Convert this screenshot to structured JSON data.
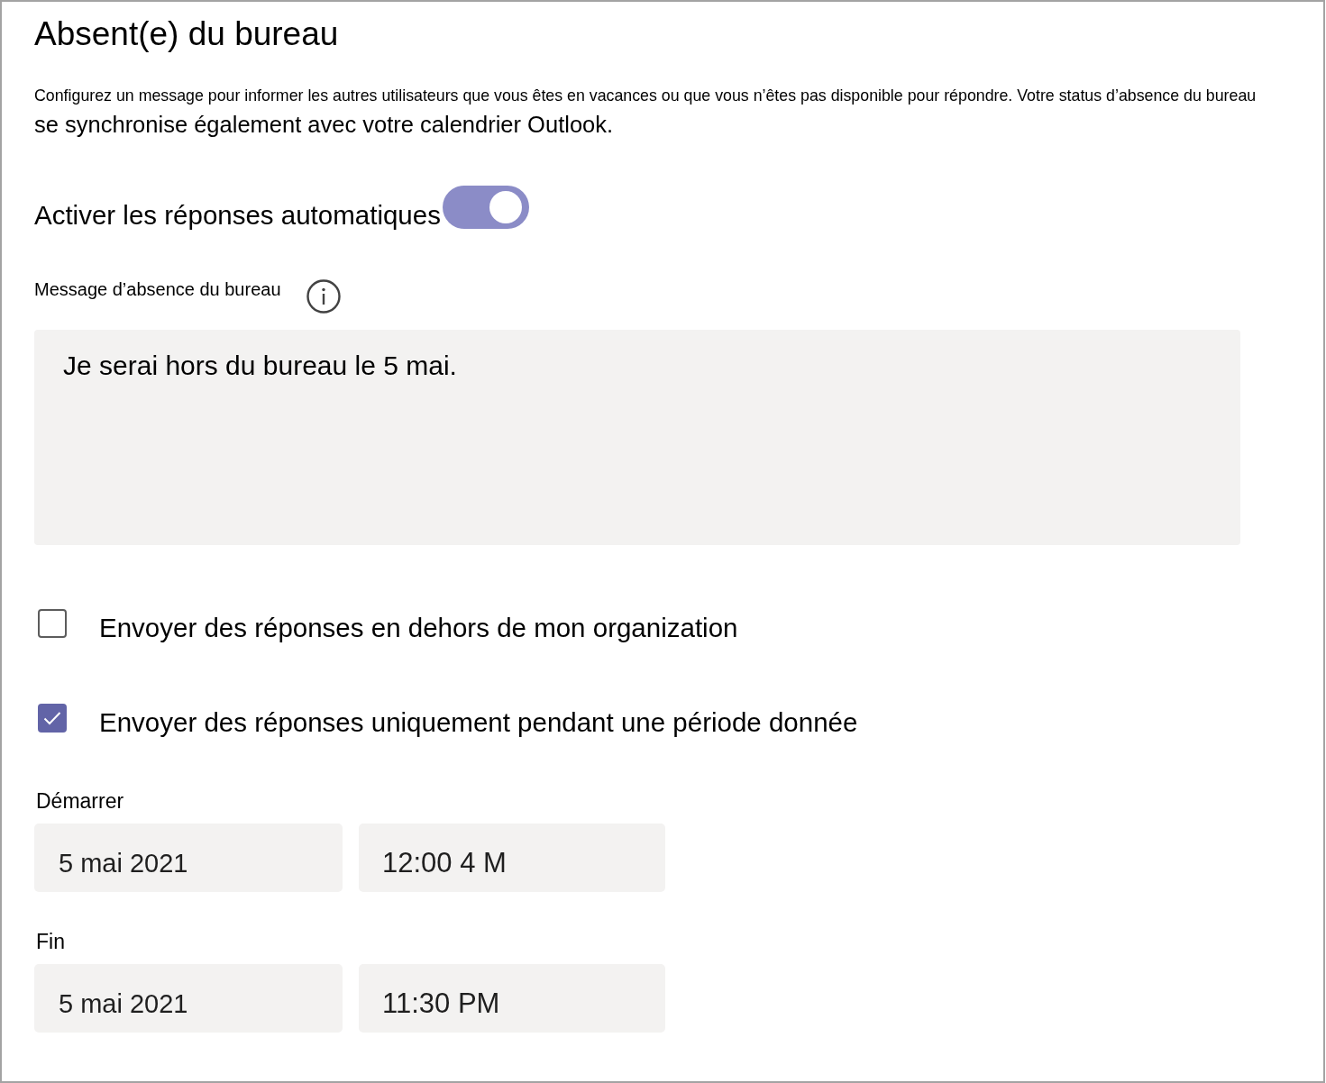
{
  "title": "Absent(e) du bureau",
  "description": [
    "Configurez un message pour informer les autres utilisateurs que vous êtes en vacances ou que vous n’êtes pas disponible pour répondre. Votre status d’absence du bureau",
    "se synchronise également avec votre calendrier Outlook."
  ],
  "auto_reply": {
    "label": "Activer les réponses automatiques",
    "on": true
  },
  "message": {
    "label": "Message d’absence du bureau",
    "value": "Je serai hors du bureau le 5 mai."
  },
  "options": [
    {
      "label": "Envoyer des réponses en dehors de mon organization",
      "checked": false
    },
    {
      "label": "Envoyer des réponses uniquement pendant une période donnée",
      "checked": true
    }
  ],
  "schedule": [
    {
      "label": "Démarrer",
      "date": "5 mai 2021",
      "time": "12:00 4 M"
    },
    {
      "label": "Fin",
      "date": "5 mai 2021",
      "time": "11:30 PM"
    }
  ]
}
